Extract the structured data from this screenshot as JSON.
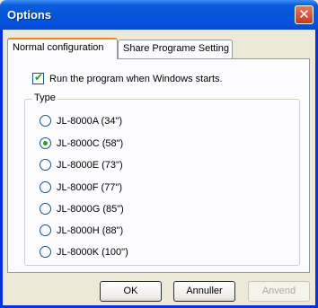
{
  "window": {
    "title": "Options",
    "close_symbol": "✕"
  },
  "tabs": [
    {
      "label": "Normal configuration",
      "active": true
    },
    {
      "label": "Share Programe Setting",
      "active": false
    }
  ],
  "startup": {
    "label": "Run the program when Windows starts.",
    "checked": true
  },
  "type_group": {
    "legend": "Type",
    "options": [
      {
        "label": "JL-8000A (34\")",
        "selected": false
      },
      {
        "label": "JL-8000C (58\")",
        "selected": true
      },
      {
        "label": "JL-8000E (73\")",
        "selected": false
      },
      {
        "label": "JL-8000F (77\")",
        "selected": false
      },
      {
        "label": "JL-8000G (85\")",
        "selected": false
      },
      {
        "label": "JL-8000H (88\")",
        "selected": false
      },
      {
        "label": "JL-8000K (100\")",
        "selected": false
      }
    ]
  },
  "buttons": {
    "ok": "OK",
    "cancel": "Annuller",
    "apply": "Anvend"
  },
  "colors": {
    "accent": "#0454d8",
    "tab_highlight": "#e68b2c",
    "check": "#21a121"
  }
}
